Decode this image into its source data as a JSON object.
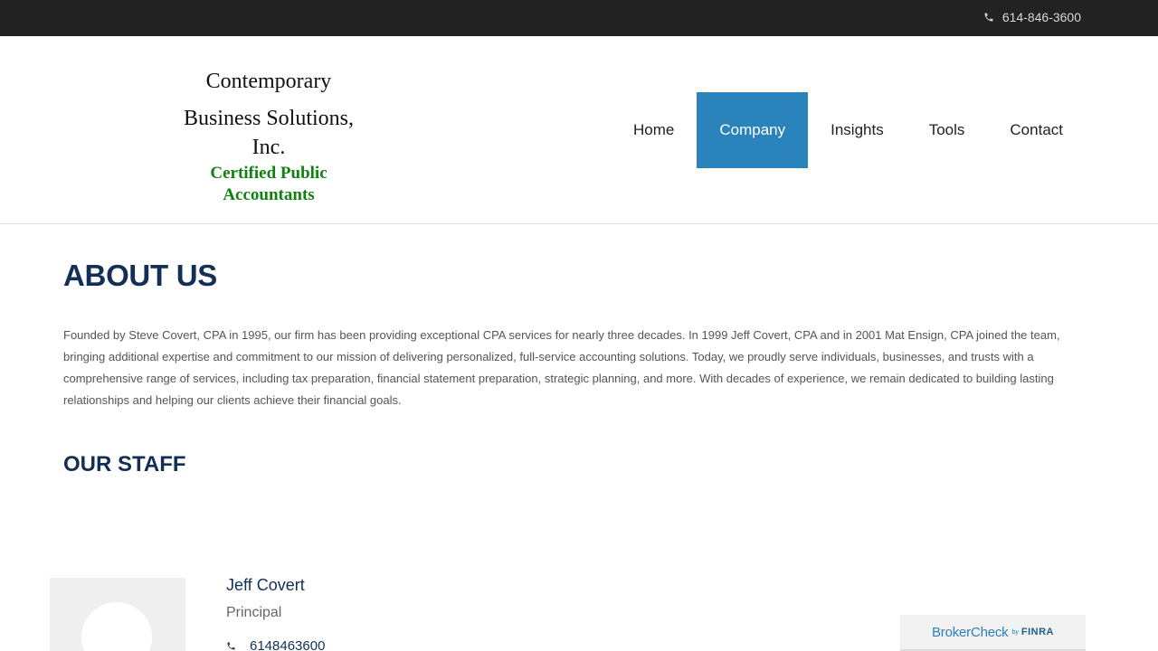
{
  "topbar": {
    "phone_icon": "phone-icon",
    "phone": "614-846-3600"
  },
  "logo": {
    "line1": "Contemporary",
    "line2": "Business Solutions, Inc.",
    "line3": "Certified Public Accountants",
    "line3_color": "#108010"
  },
  "nav": {
    "items": [
      {
        "label": "Home"
      },
      {
        "label": "Company",
        "active": true
      },
      {
        "label": "Insights"
      },
      {
        "label": "Tools"
      },
      {
        "label": "Contact"
      }
    ],
    "active_color": "#2a84bb"
  },
  "about": {
    "title": "ABOUT US",
    "text": "Founded by Steve Covert, CPA in 1995, our firm has been providing exceptional CPA services for nearly three decades. In 1999 Jeff Covert, CPA and in 2001 Mat Ensign, CPA joined the team, bringing additional expertise and commitment to our mission of delivering personalized, full-service accounting solutions. Today, we proudly serve individuals, businesses, and trusts with a comprehensive range of services, including tax preparation, financial statement preparation, strategic planning, and more. With decades of experience, we remain dedicated to building lasting relationships and helping our clients achieve their financial goals."
  },
  "staff": {
    "title": "OUR STAFF",
    "members": [
      {
        "name": "Jeff Covert",
        "role": "Principal",
        "phone": "6148463600",
        "phone_icon": "phone-icon"
      }
    ]
  },
  "brokercheck": {
    "brand": "BrokerCheck",
    "by": "by",
    "finra": "FINRA"
  },
  "colors": {
    "heading": "#132f55",
    "topbar_bg": "#222222"
  }
}
